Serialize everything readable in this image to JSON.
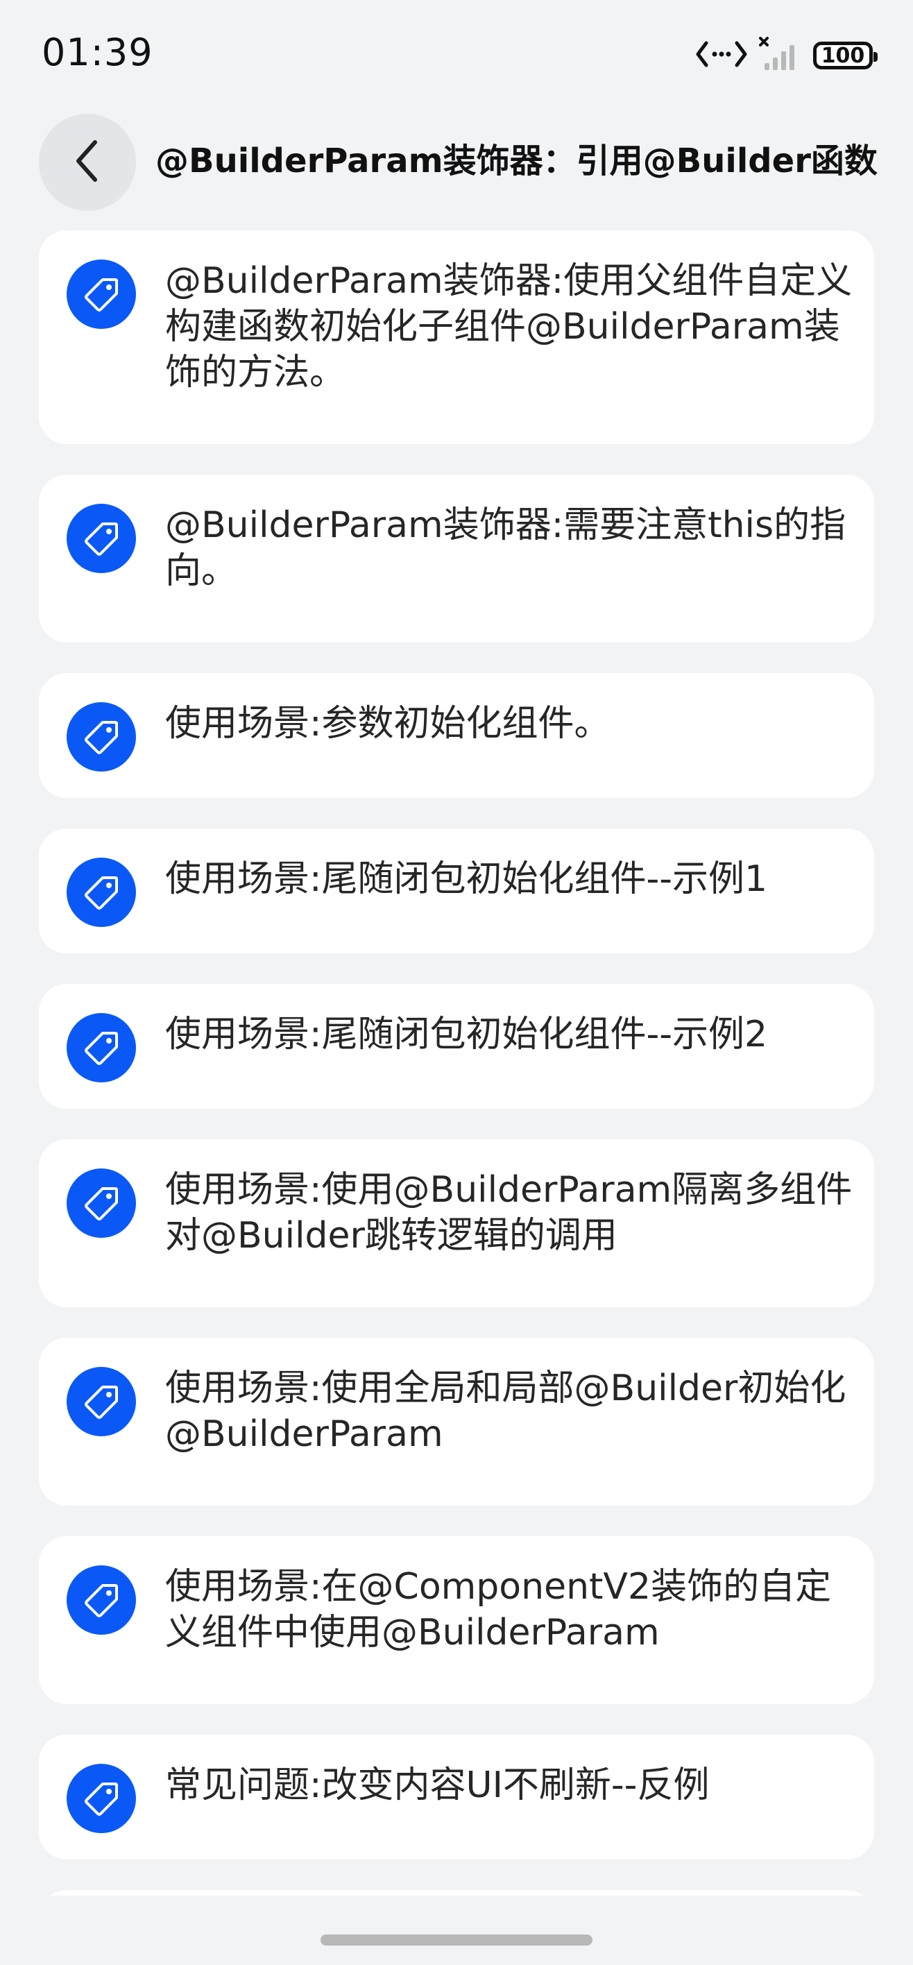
{
  "status_bar": {
    "time": "01:39",
    "battery": "100",
    "icons": [
      "data-transfer-icon",
      "signal-icon",
      "battery-icon"
    ]
  },
  "header": {
    "back_icon": "chevron-left-icon",
    "title": "@BuilderParam装饰器：引用@Builder函数"
  },
  "list": {
    "item_icon": "tag-icon",
    "accent_color": "#0a59f7",
    "items": [
      {
        "label": "@BuilderParam装饰器:使用父组件自定义构建函数初始化子组件@BuilderParam装饰的方法。"
      },
      {
        "label": "@BuilderParam装饰器:需要注意this的指向。"
      },
      {
        "label": "使用场景:参数初始化组件。"
      },
      {
        "label": "使用场景:尾随闭包初始化组件--示例1"
      },
      {
        "label": "使用场景:尾随闭包初始化组件--示例2"
      },
      {
        "label": "使用场景:使用@BuilderParam隔离多组件对@Builder跳转逻辑的调用"
      },
      {
        "label": "使用场景:使用全局和局部@Builder初始化@BuilderParam"
      },
      {
        "label": "使用场景:在@ComponentV2装饰的自定义组件中使用@BuilderParam"
      },
      {
        "label": "常见问题:改变内容UI不刷新--反例"
      }
    ]
  }
}
